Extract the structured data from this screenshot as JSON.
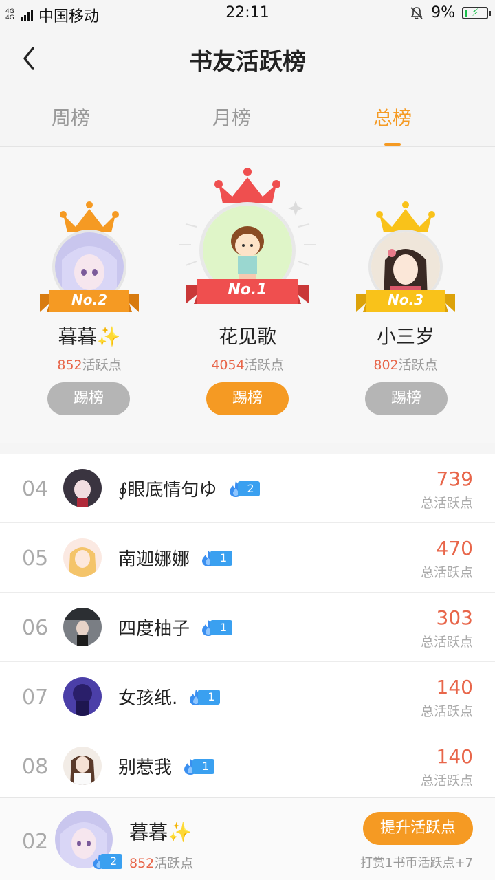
{
  "status": {
    "net": "4G 4G",
    "carrier": "中国移动",
    "time": "22:11",
    "battery": "9%"
  },
  "header": {
    "title": "书友活跃榜"
  },
  "tabs": [
    {
      "label": "周榜",
      "active": false
    },
    {
      "label": "月榜",
      "active": false
    },
    {
      "label": "总榜",
      "active": true
    }
  ],
  "podium": [
    {
      "rank_label": "No.2",
      "name": "暮暮✨",
      "points": "852",
      "points_suffix": "活跃点",
      "button": "踢榜",
      "crown_color": "#f59a23"
    },
    {
      "rank_label": "No.1",
      "name": "花见歌",
      "points": "4054",
      "points_suffix": "活跃点",
      "button": "踢榜",
      "crown_color": "#ef4f4f"
    },
    {
      "rank_label": "No.3",
      "name": "小三岁",
      "points": "802",
      "points_suffix": "活跃点",
      "button": "踢榜",
      "crown_color": "#f9c21a"
    }
  ],
  "list": [
    {
      "rank": "04",
      "name": "∮眼底情句ゆ",
      "level": "2",
      "score": "739",
      "score_label": "总活跃点"
    },
    {
      "rank": "05",
      "name": "南迦娜娜",
      "level": "1",
      "score": "470",
      "score_label": "总活跃点"
    },
    {
      "rank": "06",
      "name": "四度柚子",
      "level": "1",
      "score": "303",
      "score_label": "总活跃点"
    },
    {
      "rank": "07",
      "name": "女孩纸.",
      "level": "1",
      "score": "140",
      "score_label": "总活跃点"
    },
    {
      "rank": "08",
      "name": "别惹我",
      "level": "1",
      "score": "140",
      "score_label": "总活跃点"
    }
  ],
  "me": {
    "rank": "02",
    "name": "暮暮✨",
    "level": "2",
    "points": "852",
    "points_suffix": "活跃点",
    "button": "提升活跃点",
    "tip": "打赏1书币活跃点+7"
  },
  "colors": {
    "accent": "#f59a23",
    "score": "#e8664a",
    "level_badge": "#3aa0f0",
    "kick_gray": "#b5b5b5"
  }
}
